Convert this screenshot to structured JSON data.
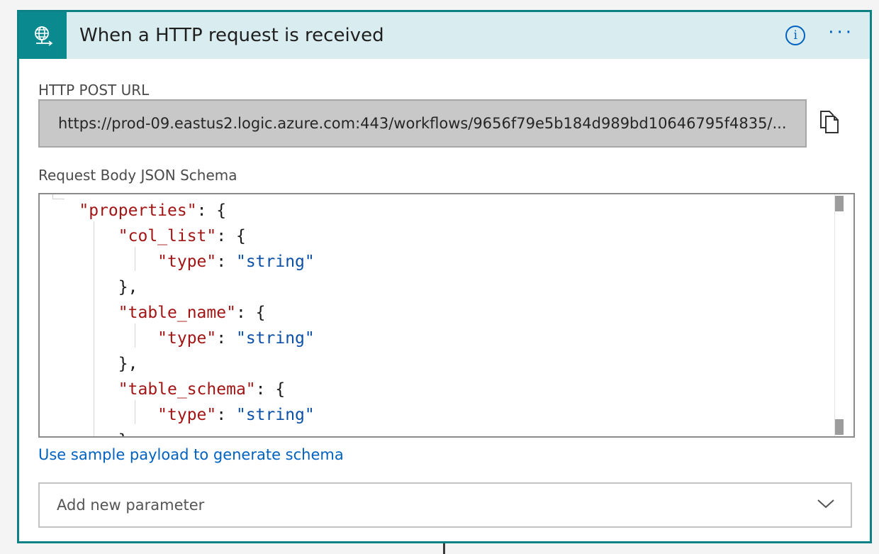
{
  "header": {
    "title": "When a HTTP request is received",
    "trigger_icon": "globe-request-icon",
    "info_icon": "info-icon",
    "info_glyph": "i",
    "more_icon": "ellipsis-icon",
    "more_glyph": "···"
  },
  "url_field": {
    "label": "HTTP POST URL",
    "value": "https://prod-09.eastus2.logic.azure.com:443/workflows/9656f79e5b184d989bd10646795f4835/...",
    "copy_icon": "copy-icon"
  },
  "schema_field": {
    "label": "Request Body JSON Schema",
    "lines": [
      {
        "pre": "    ",
        "key": "\"properties\"",
        "punct": ": {",
        "value": ""
      },
      {
        "pre": "        ",
        "key": "\"col_list\"",
        "punct": ": {",
        "value": ""
      },
      {
        "pre": "            ",
        "key": "\"type\"",
        "punct": ": ",
        "value": "\"string\""
      },
      {
        "pre": "        ",
        "key": "",
        "punct": "},",
        "value": ""
      },
      {
        "pre": "        ",
        "key": "\"table_name\"",
        "punct": ": {",
        "value": ""
      },
      {
        "pre": "            ",
        "key": "\"type\"",
        "punct": ": ",
        "value": "\"string\""
      },
      {
        "pre": "        ",
        "key": "",
        "punct": "},",
        "value": ""
      },
      {
        "pre": "        ",
        "key": "\"table_schema\"",
        "punct": ": {",
        "value": ""
      },
      {
        "pre": "            ",
        "key": "\"type\"",
        "punct": ": ",
        "value": "\"string\""
      },
      {
        "pre": "        ",
        "key": "",
        "punct": "}",
        "value": ""
      }
    ]
  },
  "sample_link": "Use sample payload to generate schema",
  "add_parameter": {
    "placeholder": "Add new parameter",
    "chevron_icon": "chevron-down-icon"
  },
  "colors": {
    "accent": "#0e8187",
    "header_bg": "#d9ecef",
    "link": "#0062c0",
    "json_key": "#a31515",
    "json_string": "#0b4fa6"
  }
}
